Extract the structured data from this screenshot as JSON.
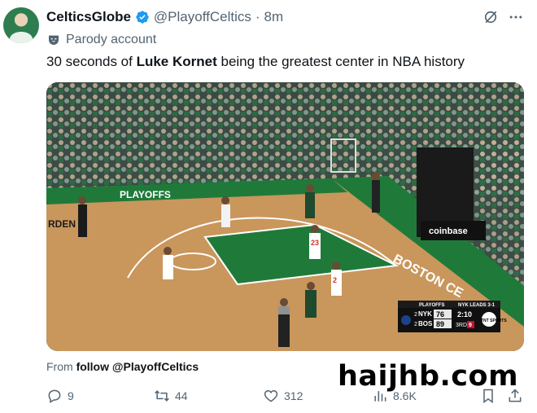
{
  "author": {
    "display_name": "CelticsGlobe",
    "handle": "@PlayoffCeltics",
    "separator": "·",
    "time": "8m",
    "label": "Parody account"
  },
  "tweet": {
    "text_before": "30 seconds of ",
    "text_bold": "Luke Kornet",
    "text_after": " being the greatest center in NBA history"
  },
  "media": {
    "court_text": "BOSTON CE",
    "baseline_text": "PLAYOFFS",
    "sideline_text": "RDEN",
    "sponsor": "coinbase",
    "jerseys": [
      "23",
      "2"
    ],
    "scorebug": {
      "brand": "PLAYOFFS",
      "series": "NYK LEADS 3-1",
      "teams": [
        {
          "abbr": "NYK",
          "seed": "2",
          "score": "76"
        },
        {
          "abbr": "BOS",
          "seed": "2",
          "score": "89"
        }
      ],
      "clock": "2:10",
      "quarter": "3RD",
      "shot_clock": "9",
      "network": "TNT SPORTS"
    }
  },
  "attribution": {
    "prefix": "From",
    "source": "follow @PlayoffCeltics"
  },
  "actions": {
    "replies": "9",
    "reposts": "44",
    "likes": "312",
    "views": "8.6K"
  },
  "watermark": "haijhb.com",
  "colors": {
    "verified": "#1d9bf0",
    "text_primary": "#0f1419",
    "text_secondary": "#536471",
    "court_green": "#1f7a3a",
    "court_wood": "#c9965c"
  }
}
